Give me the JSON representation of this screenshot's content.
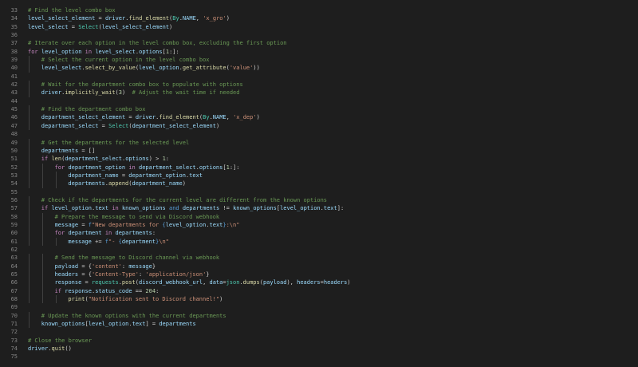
{
  "editor": {
    "language": "python",
    "colors": {
      "background": "#1e1e1e",
      "line_number": "#858585",
      "comment": "#6a9955",
      "keyword": "#c586c0",
      "keyword_blue": "#569cd6",
      "variable": "#9cdcfe",
      "function": "#dcdcaa",
      "string": "#ce9178",
      "number": "#b5cea8",
      "class": "#4ec9b0",
      "text": "#d4d4d4"
    },
    "lines": [
      {
        "number": "33",
        "indent": 0,
        "tokens": [
          {
            "t": "# Find the level combo box",
            "k": "com"
          }
        ]
      },
      {
        "number": "34",
        "indent": 0,
        "tokens": [
          {
            "t": "level_select_element",
            "k": "var"
          },
          {
            "t": " = ",
            "k": "plain"
          },
          {
            "t": "driver",
            "k": "var"
          },
          {
            "t": ".",
            "k": "plain"
          },
          {
            "t": "find_element",
            "k": "fn"
          },
          {
            "t": "(",
            "k": "plain"
          },
          {
            "t": "By",
            "k": "cls"
          },
          {
            "t": ".",
            "k": "plain"
          },
          {
            "t": "NAME",
            "k": "var"
          },
          {
            "t": ", ",
            "k": "plain"
          },
          {
            "t": "'x_gro'",
            "k": "str"
          },
          {
            "t": ")",
            "k": "plain"
          }
        ]
      },
      {
        "number": "35",
        "indent": 0,
        "tokens": [
          {
            "t": "level_select",
            "k": "var"
          },
          {
            "t": " = ",
            "k": "plain"
          },
          {
            "t": "Select",
            "k": "cls"
          },
          {
            "t": "(",
            "k": "plain"
          },
          {
            "t": "level_select_element",
            "k": "var"
          },
          {
            "t": ")",
            "k": "plain"
          }
        ]
      },
      {
        "number": "36",
        "indent": 0,
        "tokens": []
      },
      {
        "number": "37",
        "indent": 0,
        "tokens": [
          {
            "t": "# Iterate over each option in the level combo box, excluding the first option",
            "k": "com"
          }
        ]
      },
      {
        "number": "38",
        "indent": 0,
        "tokens": [
          {
            "t": "for",
            "k": "kw"
          },
          {
            "t": " ",
            "k": "plain"
          },
          {
            "t": "level_option",
            "k": "var"
          },
          {
            "t": " in ",
            "k": "kw"
          },
          {
            "t": "level_select",
            "k": "var"
          },
          {
            "t": ".",
            "k": "plain"
          },
          {
            "t": "options",
            "k": "var"
          },
          {
            "t": "[",
            "k": "plain"
          },
          {
            "t": "1",
            "k": "num"
          },
          {
            "t": ":]:",
            "k": "plain"
          }
        ]
      },
      {
        "number": "39",
        "indent": 1,
        "tokens": [
          {
            "t": "# Select the current option in the level combo box",
            "k": "com"
          }
        ]
      },
      {
        "number": "40",
        "indent": 1,
        "tokens": [
          {
            "t": "level_select",
            "k": "var"
          },
          {
            "t": ".",
            "k": "plain"
          },
          {
            "t": "select_by_value",
            "k": "fn"
          },
          {
            "t": "(",
            "k": "plain"
          },
          {
            "t": "level_option",
            "k": "var"
          },
          {
            "t": ".",
            "k": "plain"
          },
          {
            "t": "get_attribute",
            "k": "fn"
          },
          {
            "t": "(",
            "k": "plain"
          },
          {
            "t": "'value'",
            "k": "str"
          },
          {
            "t": "))",
            "k": "plain"
          }
        ]
      },
      {
        "number": "41",
        "indent": 0,
        "tokens": []
      },
      {
        "number": "42",
        "indent": 1,
        "tokens": [
          {
            "t": "# Wait for the department combo box to populate with options",
            "k": "com"
          }
        ]
      },
      {
        "number": "43",
        "indent": 1,
        "tokens": [
          {
            "t": "driver",
            "k": "var"
          },
          {
            "t": ".",
            "k": "plain"
          },
          {
            "t": "implicitly_wait",
            "k": "fn"
          },
          {
            "t": "(",
            "k": "plain"
          },
          {
            "t": "3",
            "k": "num"
          },
          {
            "t": ")  ",
            "k": "plain"
          },
          {
            "t": "# Adjust the wait time if needed",
            "k": "com"
          }
        ]
      },
      {
        "number": "44",
        "indent": 0,
        "tokens": []
      },
      {
        "number": "45",
        "indent": 1,
        "tokens": [
          {
            "t": "# Find the department combo box",
            "k": "com"
          }
        ]
      },
      {
        "number": "46",
        "indent": 1,
        "tokens": [
          {
            "t": "department_select_element",
            "k": "var"
          },
          {
            "t": " = ",
            "k": "plain"
          },
          {
            "t": "driver",
            "k": "var"
          },
          {
            "t": ".",
            "k": "plain"
          },
          {
            "t": "find_element",
            "k": "fn"
          },
          {
            "t": "(",
            "k": "plain"
          },
          {
            "t": "By",
            "k": "cls"
          },
          {
            "t": ".",
            "k": "plain"
          },
          {
            "t": "NAME",
            "k": "var"
          },
          {
            "t": ", ",
            "k": "plain"
          },
          {
            "t": "'x_dep'",
            "k": "str"
          },
          {
            "t": ")",
            "k": "plain"
          }
        ]
      },
      {
        "number": "47",
        "indent": 1,
        "tokens": [
          {
            "t": "department_select",
            "k": "var"
          },
          {
            "t": " = ",
            "k": "plain"
          },
          {
            "t": "Select",
            "k": "cls"
          },
          {
            "t": "(",
            "k": "plain"
          },
          {
            "t": "department_select_element",
            "k": "var"
          },
          {
            "t": ")",
            "k": "plain"
          }
        ]
      },
      {
        "number": "48",
        "indent": 0,
        "tokens": []
      },
      {
        "number": "49",
        "indent": 1,
        "tokens": [
          {
            "t": "# Get the departments for the selected level",
            "k": "com"
          }
        ]
      },
      {
        "number": "50",
        "indent": 1,
        "tokens": [
          {
            "t": "departments",
            "k": "var"
          },
          {
            "t": " = []",
            "k": "plain"
          }
        ]
      },
      {
        "number": "51",
        "indent": 1,
        "tokens": [
          {
            "t": "if",
            "k": "kw"
          },
          {
            "t": " ",
            "k": "plain"
          },
          {
            "t": "len",
            "k": "fn"
          },
          {
            "t": "(",
            "k": "plain"
          },
          {
            "t": "department_select",
            "k": "var"
          },
          {
            "t": ".",
            "k": "plain"
          },
          {
            "t": "options",
            "k": "var"
          },
          {
            "t": ") > ",
            "k": "plain"
          },
          {
            "t": "1",
            "k": "num"
          },
          {
            "t": ":",
            "k": "plain"
          }
        ]
      },
      {
        "number": "52",
        "indent": 2,
        "tokens": [
          {
            "t": "for",
            "k": "kw"
          },
          {
            "t": " ",
            "k": "plain"
          },
          {
            "t": "department_option",
            "k": "var"
          },
          {
            "t": " in ",
            "k": "kw"
          },
          {
            "t": "department_select",
            "k": "var"
          },
          {
            "t": ".",
            "k": "plain"
          },
          {
            "t": "options",
            "k": "var"
          },
          {
            "t": "[",
            "k": "plain"
          },
          {
            "t": "1",
            "k": "num"
          },
          {
            "t": ":]:",
            "k": "plain"
          }
        ]
      },
      {
        "number": "53",
        "indent": 3,
        "tokens": [
          {
            "t": "department_name",
            "k": "var"
          },
          {
            "t": " = ",
            "k": "plain"
          },
          {
            "t": "department_option",
            "k": "var"
          },
          {
            "t": ".",
            "k": "plain"
          },
          {
            "t": "text",
            "k": "var"
          }
        ]
      },
      {
        "number": "54",
        "indent": 3,
        "tokens": [
          {
            "t": "departments",
            "k": "var"
          },
          {
            "t": ".",
            "k": "plain"
          },
          {
            "t": "append",
            "k": "fn"
          },
          {
            "t": "(",
            "k": "plain"
          },
          {
            "t": "department_name",
            "k": "var"
          },
          {
            "t": ")",
            "k": "plain"
          }
        ]
      },
      {
        "number": "55",
        "indent": 0,
        "tokens": []
      },
      {
        "number": "56",
        "indent": 1,
        "tokens": [
          {
            "t": "# Check if the departments for the current level are different from the known options",
            "k": "com"
          }
        ]
      },
      {
        "number": "57",
        "indent": 1,
        "tokens": [
          {
            "t": "if",
            "k": "kw"
          },
          {
            "t": " ",
            "k": "plain"
          },
          {
            "t": "level_option",
            "k": "var"
          },
          {
            "t": ".",
            "k": "plain"
          },
          {
            "t": "text",
            "k": "var"
          },
          {
            "t": " in ",
            "k": "kw"
          },
          {
            "t": "known_options",
            "k": "var"
          },
          {
            "t": " and ",
            "k": "kw2"
          },
          {
            "t": "departments",
            "k": "var"
          },
          {
            "t": " != ",
            "k": "plain"
          },
          {
            "t": "known_options",
            "k": "var"
          },
          {
            "t": "[",
            "k": "plain"
          },
          {
            "t": "level_option",
            "k": "var"
          },
          {
            "t": ".",
            "k": "plain"
          },
          {
            "t": "text",
            "k": "var"
          },
          {
            "t": "]:",
            "k": "plain"
          }
        ]
      },
      {
        "number": "58",
        "indent": 2,
        "tokens": [
          {
            "t": "# Prepare the message to send via Discord webhook",
            "k": "com"
          }
        ]
      },
      {
        "number": "59",
        "indent": 2,
        "tokens": [
          {
            "t": "message",
            "k": "var"
          },
          {
            "t": " = ",
            "k": "plain"
          },
          {
            "t": "f",
            "k": "kw2"
          },
          {
            "t": "\"New departments for ",
            "k": "str"
          },
          {
            "t": "{",
            "k": "brace"
          },
          {
            "t": "level_option",
            "k": "var"
          },
          {
            "t": ".",
            "k": "plain"
          },
          {
            "t": "text",
            "k": "var"
          },
          {
            "t": "}",
            "k": "brace"
          },
          {
            "t": ":\\n\"",
            "k": "str"
          }
        ]
      },
      {
        "number": "60",
        "indent": 2,
        "tokens": [
          {
            "t": "for",
            "k": "kw"
          },
          {
            "t": " ",
            "k": "plain"
          },
          {
            "t": "department",
            "k": "var"
          },
          {
            "t": " in ",
            "k": "kw"
          },
          {
            "t": "departments",
            "k": "var"
          },
          {
            "t": ":",
            "k": "plain"
          }
        ]
      },
      {
        "number": "61",
        "indent": 3,
        "tokens": [
          {
            "t": "message",
            "k": "var"
          },
          {
            "t": " += ",
            "k": "plain"
          },
          {
            "t": "f",
            "k": "kw2"
          },
          {
            "t": "\"- ",
            "k": "str"
          },
          {
            "t": "{",
            "k": "brace"
          },
          {
            "t": "department",
            "k": "var"
          },
          {
            "t": "}",
            "k": "brace"
          },
          {
            "t": "\\n\"",
            "k": "str"
          }
        ]
      },
      {
        "number": "62",
        "indent": 0,
        "tokens": []
      },
      {
        "number": "63",
        "indent": 2,
        "tokens": [
          {
            "t": "# Send the message to Discord channel via webhook",
            "k": "com"
          }
        ]
      },
      {
        "number": "64",
        "indent": 2,
        "tokens": [
          {
            "t": "payload",
            "k": "var"
          },
          {
            "t": " = {",
            "k": "plain"
          },
          {
            "t": "'content'",
            "k": "str"
          },
          {
            "t": ": ",
            "k": "plain"
          },
          {
            "t": "message",
            "k": "var"
          },
          {
            "t": "}",
            "k": "plain"
          }
        ]
      },
      {
        "number": "65",
        "indent": 2,
        "tokens": [
          {
            "t": "headers",
            "k": "var"
          },
          {
            "t": " = {",
            "k": "plain"
          },
          {
            "t": "'Content-Type'",
            "k": "str"
          },
          {
            "t": ": ",
            "k": "plain"
          },
          {
            "t": "'application/json'",
            "k": "str"
          },
          {
            "t": "}",
            "k": "plain"
          }
        ]
      },
      {
        "number": "66",
        "indent": 2,
        "tokens": [
          {
            "t": "response",
            "k": "var"
          },
          {
            "t": " = ",
            "k": "plain"
          },
          {
            "t": "requests",
            "k": "cls"
          },
          {
            "t": ".",
            "k": "plain"
          },
          {
            "t": "post",
            "k": "fn"
          },
          {
            "t": "(",
            "k": "plain"
          },
          {
            "t": "discord_webhook_url",
            "k": "var"
          },
          {
            "t": ", ",
            "k": "plain"
          },
          {
            "t": "data",
            "k": "var"
          },
          {
            "t": "=",
            "k": "plain"
          },
          {
            "t": "json",
            "k": "cls"
          },
          {
            "t": ".",
            "k": "plain"
          },
          {
            "t": "dumps",
            "k": "fn"
          },
          {
            "t": "(",
            "k": "plain"
          },
          {
            "t": "payload",
            "k": "var"
          },
          {
            "t": "), ",
            "k": "plain"
          },
          {
            "t": "headers",
            "k": "var"
          },
          {
            "t": "=",
            "k": "plain"
          },
          {
            "t": "headers",
            "k": "var"
          },
          {
            "t": ")",
            "k": "plain"
          }
        ]
      },
      {
        "number": "67",
        "indent": 2,
        "tokens": [
          {
            "t": "if",
            "k": "kw"
          },
          {
            "t": " ",
            "k": "plain"
          },
          {
            "t": "response",
            "k": "var"
          },
          {
            "t": ".",
            "k": "plain"
          },
          {
            "t": "status_code",
            "k": "var"
          },
          {
            "t": " == ",
            "k": "plain"
          },
          {
            "t": "204",
            "k": "num"
          },
          {
            "t": ":",
            "k": "plain"
          }
        ]
      },
      {
        "number": "68",
        "indent": 3,
        "tokens": [
          {
            "t": "print",
            "k": "fn"
          },
          {
            "t": "(",
            "k": "plain"
          },
          {
            "t": "\"Notification sent to Discord channel!\"",
            "k": "str"
          },
          {
            "t": ")",
            "k": "plain"
          }
        ]
      },
      {
        "number": "69",
        "indent": 0,
        "tokens": []
      },
      {
        "number": "70",
        "indent": 1,
        "tokens": [
          {
            "t": "# Update the known options with the current departments",
            "k": "com"
          }
        ]
      },
      {
        "number": "71",
        "indent": 1,
        "tokens": [
          {
            "t": "known_options",
            "k": "var"
          },
          {
            "t": "[",
            "k": "plain"
          },
          {
            "t": "level_option",
            "k": "var"
          },
          {
            "t": ".",
            "k": "plain"
          },
          {
            "t": "text",
            "k": "var"
          },
          {
            "t": "] = ",
            "k": "plain"
          },
          {
            "t": "departments",
            "k": "var"
          }
        ]
      },
      {
        "number": "72",
        "indent": 0,
        "tokens": []
      },
      {
        "number": "73",
        "indent": 0,
        "tokens": [
          {
            "t": "# Close the browser",
            "k": "com"
          }
        ]
      },
      {
        "number": "74",
        "indent": 0,
        "tokens": [
          {
            "t": "driver",
            "k": "var"
          },
          {
            "t": ".",
            "k": "plain"
          },
          {
            "t": "quit",
            "k": "fn"
          },
          {
            "t": "()",
            "k": "plain"
          }
        ]
      },
      {
        "number": "75",
        "indent": 0,
        "tokens": []
      }
    ]
  }
}
